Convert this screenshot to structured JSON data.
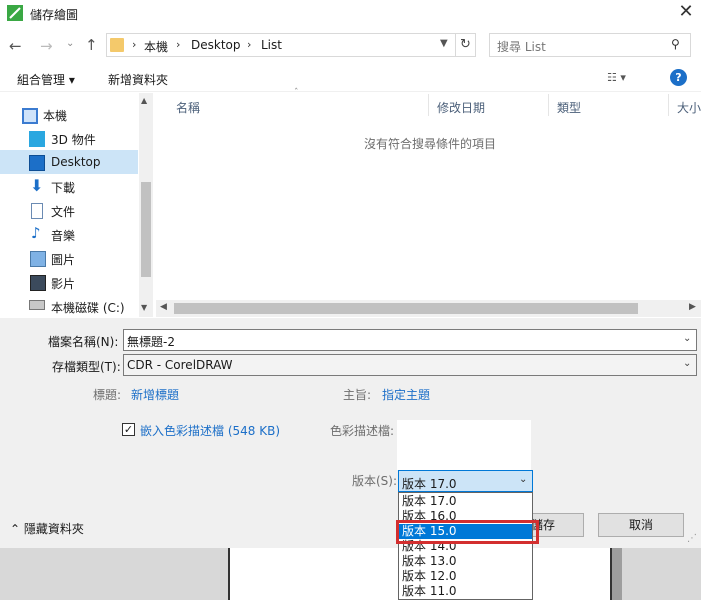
{
  "window": {
    "title": "儲存繪圖",
    "close_glyph": "✕"
  },
  "nav": {
    "back_glyph": "←",
    "forward_glyph": "→",
    "recent_glyph": "⌄",
    "up_glyph": "↑",
    "breadcrumbs": [
      "本機",
      "Desktop",
      "List"
    ],
    "search_placeholder": "搜尋 List"
  },
  "toolbar": {
    "organize_label": "組合管理 ▾",
    "new_folder_label": "新增資料夾",
    "help_label": "?"
  },
  "sidebar": {
    "items": [
      {
        "label": "本機",
        "icon": "computer-icon"
      },
      {
        "label": "3D 物件",
        "icon": "cube-icon"
      },
      {
        "label": "Desktop",
        "icon": "desktop-icon",
        "selected": true
      },
      {
        "label": "下載",
        "icon": "download-icon"
      },
      {
        "label": "文件",
        "icon": "document-icon"
      },
      {
        "label": "音樂",
        "icon": "music-icon"
      },
      {
        "label": "圖片",
        "icon": "picture-icon"
      },
      {
        "label": "影片",
        "icon": "video-icon"
      },
      {
        "label": "本機磁碟 (C:)",
        "icon": "drive-icon"
      }
    ]
  },
  "filelist": {
    "columns": [
      "名稱",
      "修改日期",
      "類型",
      "大小"
    ],
    "empty_message": "沒有符合搜尋條件的項目"
  },
  "form": {
    "filename_label": "檔案名稱(N):",
    "filename_value": "無標題-2",
    "filetype_label": "存檔類型(T):",
    "filetype_value": "CDR - CorelDRAW",
    "tags_label": "標題:",
    "tags_link": "新增標題",
    "subject_label": "主旨:",
    "subject_link": "指定主題",
    "embed_label": "嵌入色彩描述檔 (548 KB)",
    "embed_checked": true,
    "profile_label": "色彩描述檔:",
    "version_label": "版本(S):",
    "version_value": "版本 17.0",
    "version_options": [
      "版本 17.0",
      "版本 16.0",
      "版本 15.0",
      "版本 14.0",
      "版本 13.0",
      "版本 12.0",
      "版本 11.0"
    ],
    "highlighted_option": "版本 15.0",
    "save_label": "儲存",
    "cancel_label": "取消",
    "hide_folders_label": "隱藏資料夾"
  },
  "colors": {
    "accent": "#0078d7",
    "selection": "#cce4f7",
    "link": "#1c6fc8",
    "callout": "#d32f2f"
  }
}
